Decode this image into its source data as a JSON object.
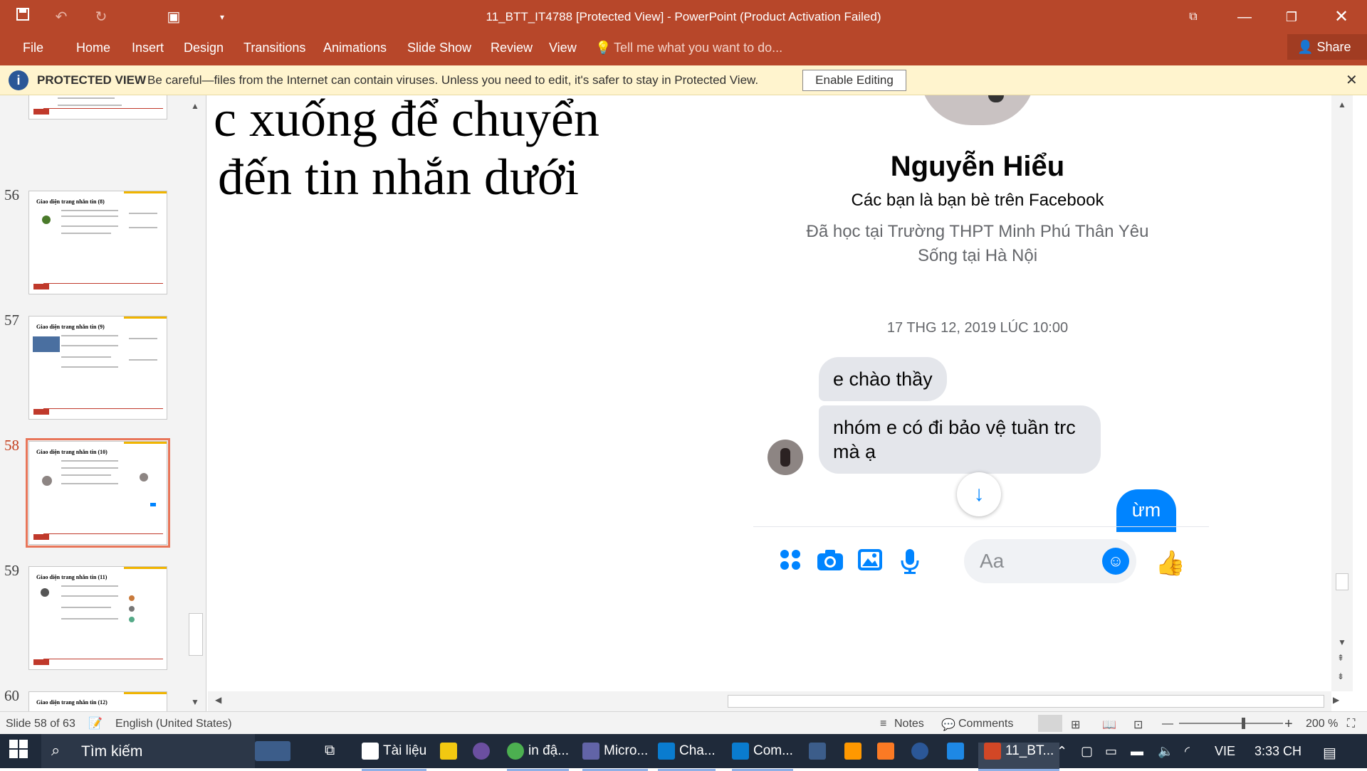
{
  "titlebar": {
    "title": "11_BTT_IT4788 [Protected View] - PowerPoint (Product Activation Failed)",
    "save_icon": "save-icon",
    "undo_icon": "undo-icon",
    "redo_icon": "redo-icon",
    "presenter_icon": "presenter-icon",
    "customize_icon": "customize-icon"
  },
  "ribbon": {
    "tabs": [
      "File",
      "Home",
      "Insert",
      "Design",
      "Transitions",
      "Animations",
      "Slide Show",
      "Review",
      "View"
    ],
    "tell_me": "Tell me what you want to do...",
    "share": "Share",
    "accent": "#b7472a"
  },
  "protected_view": {
    "label": "PROTECTED VIEW",
    "message": "Be careful—files from the Internet can contain viruses. Unless you need to edit, it's safer to stay in Protected View.",
    "button": "Enable Editing",
    "bg": "#fff4ce"
  },
  "thumbnails": [
    {
      "number": "56",
      "title": "Giao diện trang nhắn tin (8)"
    },
    {
      "number": "57",
      "title": "Giao diện trang nhắn tin (9)"
    },
    {
      "number": "58",
      "title": "Giao diện trang nhắn tin (10)",
      "selected": true
    },
    {
      "number": "59",
      "title": "Giao diện trang nhắn tin (11)"
    },
    {
      "number": "60",
      "title": "Giao diện trang nhắn tin (12)"
    }
  ],
  "slide": {
    "text_line1": "c xuống để chuyển",
    "text_line2": "đến tin nhắn dưới",
    "profile_name": "Nguyễn Hiểu",
    "friends": "Các bạn là bạn bè trên Facebook",
    "education": "Đã học tại Trường THPT Minh Phú Thân Yêu",
    "lives": "Sống tại Hà Nội",
    "timestamp": "17 THG 12, 2019 LÚC 10:00",
    "messages": [
      "e chào thầy",
      "nhóm e có đi bảo vệ tuần trc mà ạ"
    ],
    "my_message": "ừm",
    "input_placeholder": "Aa",
    "messenger_blue": "#0084ff"
  },
  "status": {
    "slide_info": "Slide 58 of 63",
    "language": "English (United States)",
    "notes": "Notes",
    "comments": "Comments",
    "zoom": "200 %"
  },
  "taskbar": {
    "search": "Tìm kiếm",
    "items": [
      "Tài liệu",
      "in đậ...",
      "Micro...",
      "Cha...",
      "Com...",
      "11_BT..."
    ],
    "lang": "VIE",
    "time": "3:33 CH"
  }
}
